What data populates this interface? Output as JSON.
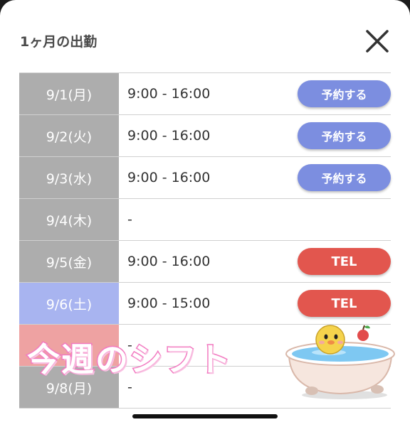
{
  "modal": {
    "title": "1ヶ月の出勤",
    "close_icon": "close-icon"
  },
  "schedule": [
    {
      "date": "9/1(月)",
      "time": "9:00 - 16:00",
      "action": "予約する",
      "action_type": "reserve"
    },
    {
      "date": "9/2(火)",
      "time": "9:00 - 16:00",
      "action": "予約する",
      "action_type": "reserve"
    },
    {
      "date": "9/3(水)",
      "time": "9:00 - 16:00",
      "action": "予約する",
      "action_type": "reserve"
    },
    {
      "date": "9/4(木)",
      "time": "-",
      "action": "",
      "action_type": "none"
    },
    {
      "date": "9/5(金)",
      "time": "9:00 - 16:00",
      "action": "TEL",
      "action_type": "tel"
    },
    {
      "date": "9/6(土)",
      "time": "9:00 - 15:00",
      "action": "TEL",
      "action_type": "tel"
    },
    {
      "date": "",
      "time": "-",
      "action": "",
      "action_type": "none"
    },
    {
      "date": "9/8(月)",
      "time": "-",
      "action": "",
      "action_type": "none"
    }
  ],
  "overlay": {
    "text": "今週のシフト",
    "illustration": "bathtub-mascot-icon"
  },
  "colors": {
    "weekday": "#adadad",
    "saturday": "#a8b4f0",
    "sunday": "#eea2a2",
    "reserve_button": "#7c8ee0",
    "tel_button": "#e2564e",
    "overlay_stroke": "#f27bc1"
  }
}
